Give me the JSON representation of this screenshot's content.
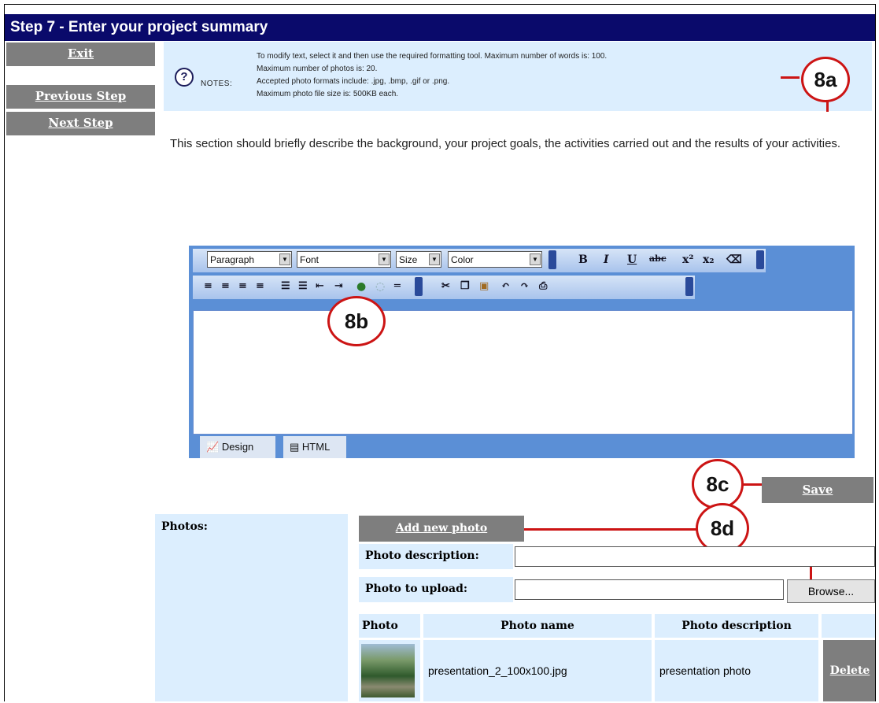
{
  "title": "Step 7 - Enter your project summary",
  "nav": {
    "exit": "Exit",
    "previous": "Previous Step",
    "next": "Next Step"
  },
  "notes": {
    "icon": "?",
    "label": "NOTES:",
    "lines": [
      "To modify text, select it and then use the required formatting tool. Maximum number of words is: 100.",
      "Maximum number of photos is: 20.",
      "Accepted photo formats include: .jpg, .bmp, .gif or .png.",
      "Maximum photo file size is: 500KB each."
    ]
  },
  "intro": "This section should briefly describe the background, your project goals, the activities carried out and the results of your activities.",
  "callouts": {
    "a": "8a",
    "b": "8b",
    "c": "8c",
    "d": "8d"
  },
  "editor": {
    "paragraph": "Paragraph",
    "font": "Font",
    "size": "Size",
    "color": "Color",
    "tab_design": "Design",
    "tab_html": "HTML"
  },
  "save": "Save",
  "photos": {
    "label": "Photos:",
    "add_button": "Add new photo",
    "description_label": "Photo description:",
    "upload_label": "Photo to upload:",
    "browse": "Browse...",
    "columns": [
      "Photo",
      "Photo name",
      "Photo description"
    ],
    "rows": [
      {
        "name": "presentation_2_100x100.jpg",
        "description": "presentation photo",
        "delete": "Delete"
      }
    ]
  },
  "colors": {
    "titlebar": "#0a0a6b",
    "button": "#7e7e7e",
    "panel": "#dceefe",
    "callout": "#cc1414",
    "toolbar": "#5b8fd6"
  }
}
